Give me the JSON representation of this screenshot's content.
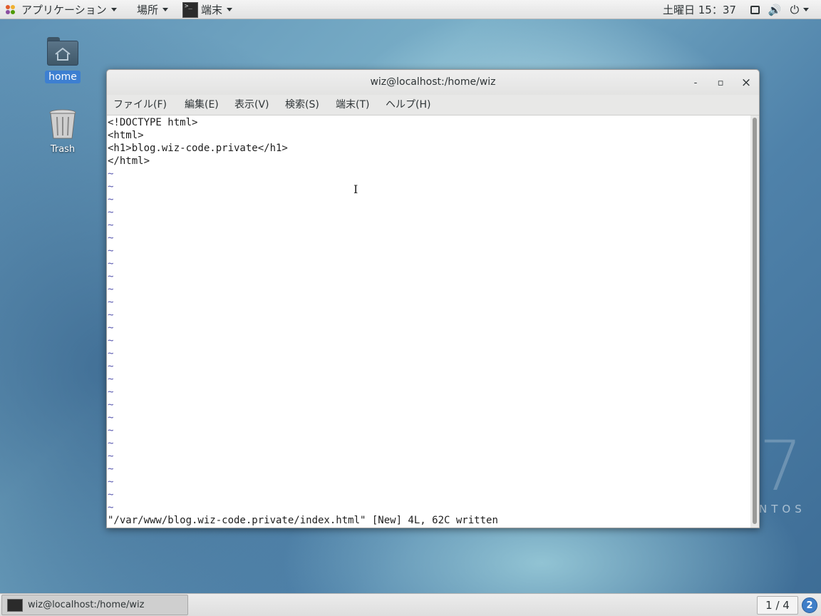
{
  "top_bar": {
    "applications_label": "アプリケーション",
    "places_label": "場所",
    "terminal_app_label": "端末",
    "clock": "土曜日 15：37"
  },
  "desktop": {
    "home_label": "home",
    "trash_label": "Trash",
    "os_watermark_number": "7",
    "os_watermark_text": "NTOS"
  },
  "window": {
    "title": "wiz@localhost:/home/wiz",
    "minimize": "‐",
    "maximize": "▫",
    "close": "×",
    "menu": [
      "ファイル(F)",
      "編集(E)",
      "表示(V)",
      "検索(S)",
      "端末(T)",
      "ヘルプ(H)"
    ]
  },
  "terminal": {
    "lines": [
      "<!DOCTYPE html>",
      "<html>",
      "<h1>blog.wiz-code.private</h1>",
      "</html>"
    ],
    "tilde": "~",
    "status": "\"/var/www/blog.wiz-code.private/index.html\" [New] 4L, 62C written",
    "cursor": "I"
  },
  "bottom_bar": {
    "task_label": "wiz@localhost:/home/wiz",
    "workspace": "1 / 4",
    "help_badge": "2"
  },
  "icons": {
    "top_bar": [
      "app-menu-icon",
      "terminal-app-icon",
      "screen-icon",
      "volume-icon",
      "power-icon"
    ],
    "desktop": [
      "home-folder-icon",
      "trash-icon"
    ]
  },
  "colors": {
    "selection_blue": "#3d7fd1",
    "tilde_blue": "#5a5ab0",
    "help_blue": "#3f7ec8"
  }
}
